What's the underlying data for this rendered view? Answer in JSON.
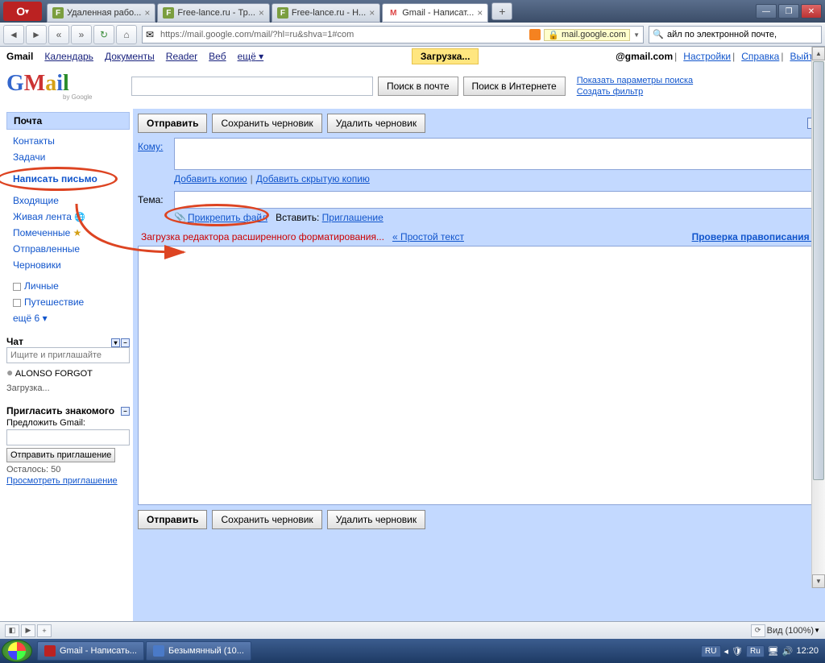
{
  "titlebar": {
    "tabs": [
      {
        "label": "Удаленная рабо...",
        "favicon": "F"
      },
      {
        "label": "Free-lance.ru - Тр...",
        "favicon": "F"
      },
      {
        "label": "Free-lance.ru - Н...",
        "favicon": "F"
      },
      {
        "label": "Gmail - Написат...",
        "favicon": "M"
      }
    ]
  },
  "navbar": {
    "url_prefix": "https://mail.google.com/mail/?hl=ru&shva=1#com",
    "security_chip": "mail.google.com",
    "search_placeholder": "айл по электронной почте,"
  },
  "gmail_header": {
    "links": [
      "Gmail",
      "Календарь",
      "Документы",
      "Reader",
      "Веб",
      "ещё"
    ],
    "loading": "Загрузка...",
    "email_suffix": "@gmail.com",
    "right_links": [
      "Настройки",
      "Справка",
      "Выйти"
    ]
  },
  "logo_row": {
    "by": "by Google",
    "search_mail": "Поиск в почте",
    "search_web": "Поиск в Интернете",
    "opt1": "Показать параметры поиска",
    "opt2": "Создать фильтр"
  },
  "sidebar": {
    "mail_header": "Почта",
    "items1": [
      "Контакты",
      "Задачи"
    ],
    "compose": "Написать письмо",
    "items2": [
      {
        "label": "Входящие"
      },
      {
        "label": "Живая лента",
        "icon": "globe"
      },
      {
        "label": "Помеченные",
        "icon": "star"
      },
      {
        "label": "Отправленные"
      },
      {
        "label": "Черновики"
      }
    ],
    "labels": [
      "Личные",
      "Путешествие"
    ],
    "more": "ещё 6 ▾",
    "chat_header": "Чат",
    "chat_placeholder": "Ищите и приглашайте",
    "chat_user": "ALONSO FORGOT",
    "chat_loading": "Загрузка...",
    "invite_header": "Пригласить знакомого",
    "invite_label": "Предложить Gmail:",
    "invite_btn": "Отправить приглашение",
    "invite_left": "Осталось: 50",
    "invite_view": "Просмотреть приглашение"
  },
  "compose": {
    "send": "Отправить",
    "save_draft": "Сохранить черновик",
    "discard": "Удалить черновик",
    "to_label": "Кому:",
    "add_cc": "Добавить копию",
    "add_bcc": "Добавить скрытую копию",
    "subject_label": "Тема:",
    "attach": "Прикрепить файл",
    "insert_label": "Вставить:",
    "invitation": "Приглашение",
    "editor_loading": "Загрузка редактора расширенного форматирования...",
    "plain_text": "« Простой текст",
    "spellcheck": "Проверка правописания ▾"
  },
  "statusbar": {
    "view": "Вид (100%)"
  },
  "taskbar": {
    "task1": "Gmail - Написать...",
    "task2": "Безымянный (10...",
    "lang": "RU",
    "lang2": "Ru",
    "time": "12:20"
  }
}
